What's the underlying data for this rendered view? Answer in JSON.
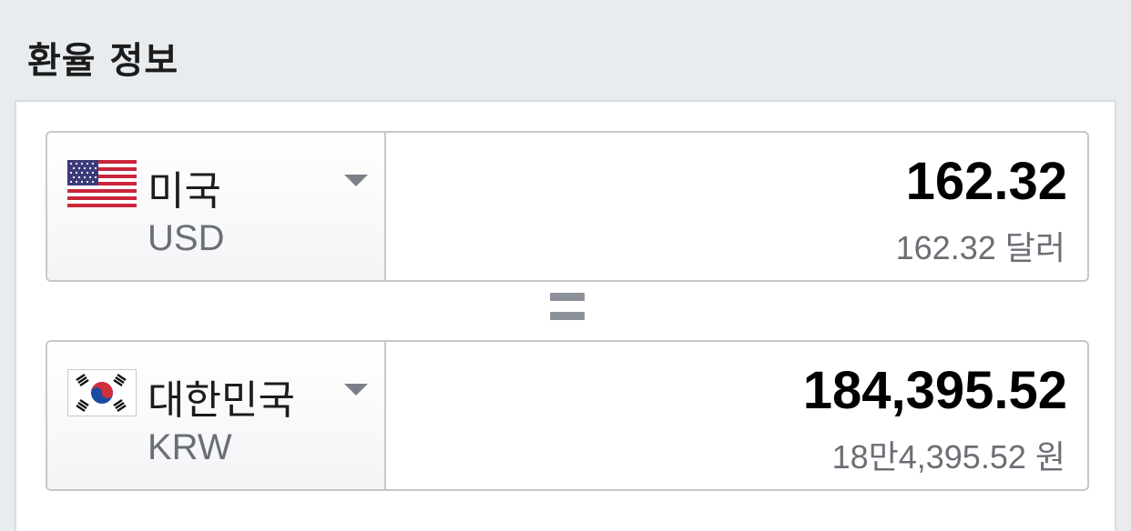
{
  "header": {
    "title": "환율 정보"
  },
  "from": {
    "country": "미국",
    "code": "USD",
    "flag_icon": "us-flag-icon",
    "amount": "162.32",
    "reading": "162.32 달러"
  },
  "to": {
    "country": "대한민국",
    "code": "KRW",
    "flag_icon": "kr-flag-icon",
    "amount": "184,395.52",
    "reading": "18만4,395.52 원"
  },
  "equals_icon": "equals-icon",
  "colors": {
    "background": "#e9ecef",
    "panel": "#ffffff",
    "border": "#c4c8cd",
    "muted_text": "#6b6f75",
    "caret": "#7a7f88"
  }
}
